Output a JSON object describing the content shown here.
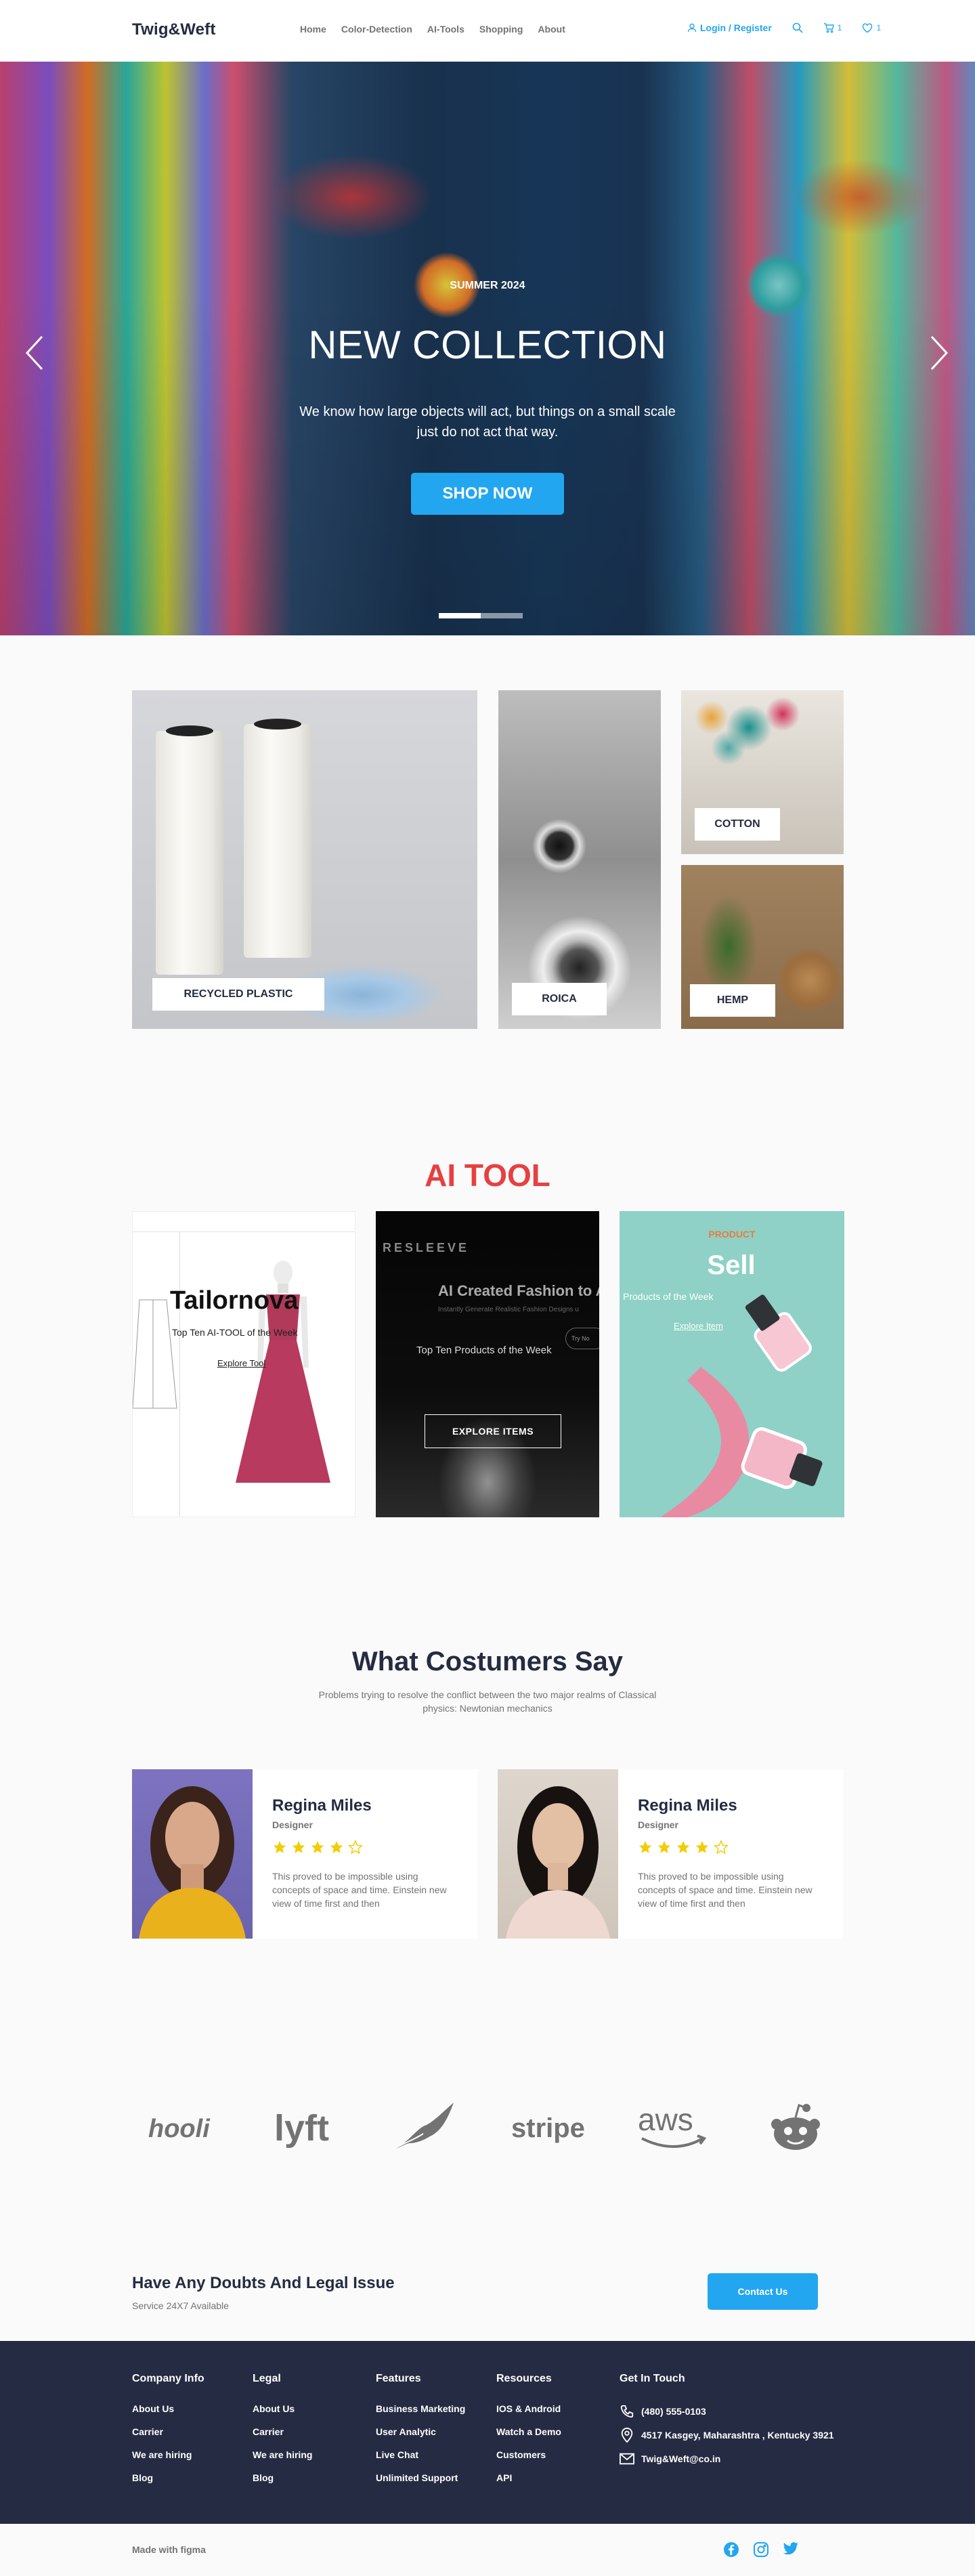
{
  "header": {
    "brand": "Twig&Weft",
    "nav": [
      "Home",
      "Color-Detection",
      "AI-Tools",
      "Shopping",
      "About"
    ],
    "login": "Login / Register",
    "cart_count": "1",
    "wishlist_count": "1",
    "accent": "#23a6f0"
  },
  "hero": {
    "season": "SUMMER 2024",
    "title": "NEW COLLECTION",
    "subtitle": "We know how large objects will act, but things on a small scale just do not act that way.",
    "button": "SHOP NOW"
  },
  "categories": [
    {
      "label": "RECYCLED PLASTIC"
    },
    {
      "label": "ROICA"
    },
    {
      "label": "COTTON"
    },
    {
      "label": "HEMP"
    }
  ],
  "ai_tool": {
    "title": "AI TOOL",
    "title_color": "#e74040",
    "card1": {
      "heading": "Tailornova",
      "subtitle": "Top Ten AI-TOOL  of the Week",
      "link": "Explore Tool"
    },
    "card2": {
      "logo": "RESLEEVE",
      "heading": "AI Created Fashion to A",
      "sub": "Instantly Generate Realistic Fashion Designs u",
      "pill": "Try No",
      "subtitle": "Top Ten Products  of the Week",
      "button": "EXPLORE ITEMS"
    },
    "card3": {
      "tag": "PRODUCT",
      "heading": "Sell",
      "subtitle": "Products  of the Week",
      "link": "Explore Item"
    }
  },
  "testimonials": {
    "title": "What Costumers Say",
    "subtitle": "Problems trying to resolve the conflict between the two major realms of Classical physics: Newtonian mechanics",
    "items": [
      {
        "name": "Regina Miles",
        "role": "Designer",
        "rating": 4,
        "quote": "This proved to be impossible using concepts of space and time. Einstein new view of time first and then"
      },
      {
        "name": "Regina Miles",
        "role": "Designer",
        "rating": 4,
        "quote": "This proved to be impossible using concepts of space and time. Einstein new view of time first and then"
      }
    ]
  },
  "logos": [
    "hooli",
    "lyft",
    "feather",
    "stripe",
    "aws",
    "reddit"
  ],
  "cta": {
    "title": "Have Any Doubts And Legal Issue",
    "subtitle": "Service 24X7 Available",
    "button": "Contact Us"
  },
  "footer": {
    "columns": [
      {
        "title": "Company Info",
        "links": [
          "About Us",
          "Carrier",
          "We are hiring",
          "Blog"
        ]
      },
      {
        "title": "Legal",
        "links": [
          "About Us",
          "Carrier",
          "We are hiring",
          "Blog"
        ]
      },
      {
        "title": "Features",
        "links": [
          "Business Marketing",
          "User Analytic",
          "Live Chat",
          "Unlimited Support"
        ]
      },
      {
        "title": "Resources",
        "links": [
          "IOS & Android",
          "Watch a Demo",
          "Customers",
          "API"
        ]
      }
    ],
    "contact": {
      "title": "Get In Touch",
      "phone": "(480) 555-0103",
      "address": "4517 Kasgey, Maharashtra , Kentucky 3921",
      "email": "Twig&Weft@co.in"
    },
    "made_with": "Made with figma",
    "bg": "#252b42"
  }
}
